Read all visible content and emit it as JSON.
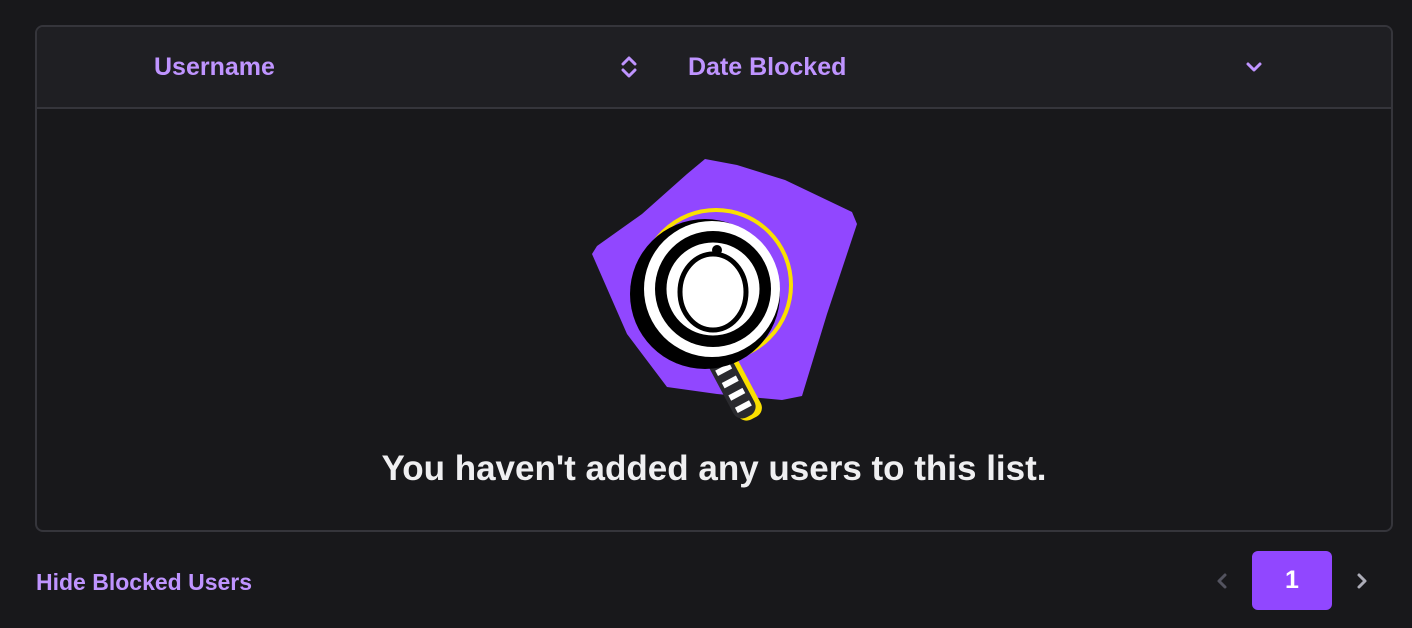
{
  "table": {
    "columns": [
      {
        "label": "Username",
        "sort_icon": "sort-both-icon"
      },
      {
        "label": "Date Blocked",
        "sort_icon": "chevron-down-icon"
      }
    ]
  },
  "empty_state": {
    "illustration": "magnifying-glass-illustration",
    "message": "You haven't added any users to this list."
  },
  "footer": {
    "hide_link": "Hide Blocked Users"
  },
  "pagination": {
    "prev_icon": "chevron-left-icon",
    "current_page": "1",
    "next_icon": "chevron-right-icon"
  },
  "colors": {
    "accent": "#bf94ff",
    "primary": "#9147ff",
    "background": "#18181b",
    "header_background": "#1f1f23",
    "border": "#35353b",
    "text": "#efeff1"
  }
}
